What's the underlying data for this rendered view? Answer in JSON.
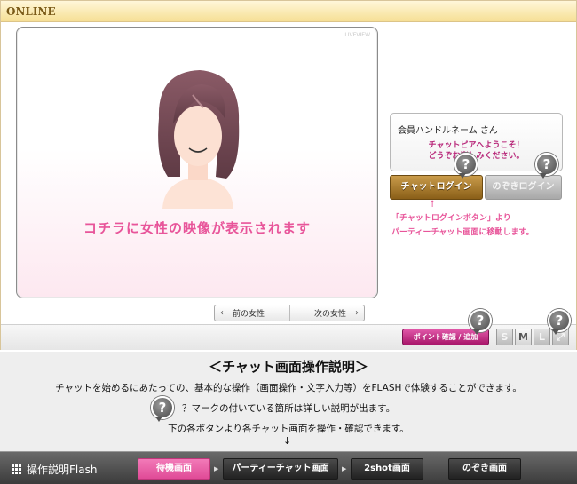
{
  "header": {
    "title": "ONLINE"
  },
  "video": {
    "corner_label": "LIVEVIEW",
    "caption": "コチラに女性の映像が表示されます"
  },
  "pager": {
    "prev_label": "前の女性",
    "next_label": "次の女性"
  },
  "welcome": {
    "member_name": "会員ハンドルネーム さん",
    "message_line1": "チャットピアへようこそ！",
    "message_line2": "どうぞお楽しみください。"
  },
  "buttons": {
    "chat_login": "チャットログイン",
    "peek_login": "のぞきログイン",
    "points": "ポイント確認 / 追加"
  },
  "login_note": {
    "arrow": "↑",
    "line1": "「チャットログインボタン」より",
    "line2": "パーティーチャット画面に移動します。"
  },
  "help": {
    "glyph": "?"
  },
  "sizes": [
    "S",
    "M",
    "L"
  ],
  "description": {
    "title": "＜チャット画面操作説明＞",
    "line1": "チャットを始めるにあたっての、基本的な操作（画面操作・文字入力等）をFLASHで体験することができます。",
    "line2": "？マークの付いている箇所は詳しい説明が出ます。",
    "line3": "下の各ボタンより各チャット画面を操作・確認できます。",
    "arrow": "↓"
  },
  "bottom_nav": {
    "title": "操作説明Flash",
    "items": [
      "待機画面",
      "パーティーチャット画面",
      "2shot画面",
      "のぞき画面"
    ],
    "active_index": 0
  },
  "colors": {
    "accent_pink": "#e8559a",
    "brand_magenta": "#b8287a",
    "header_gold": "#f6df95"
  }
}
